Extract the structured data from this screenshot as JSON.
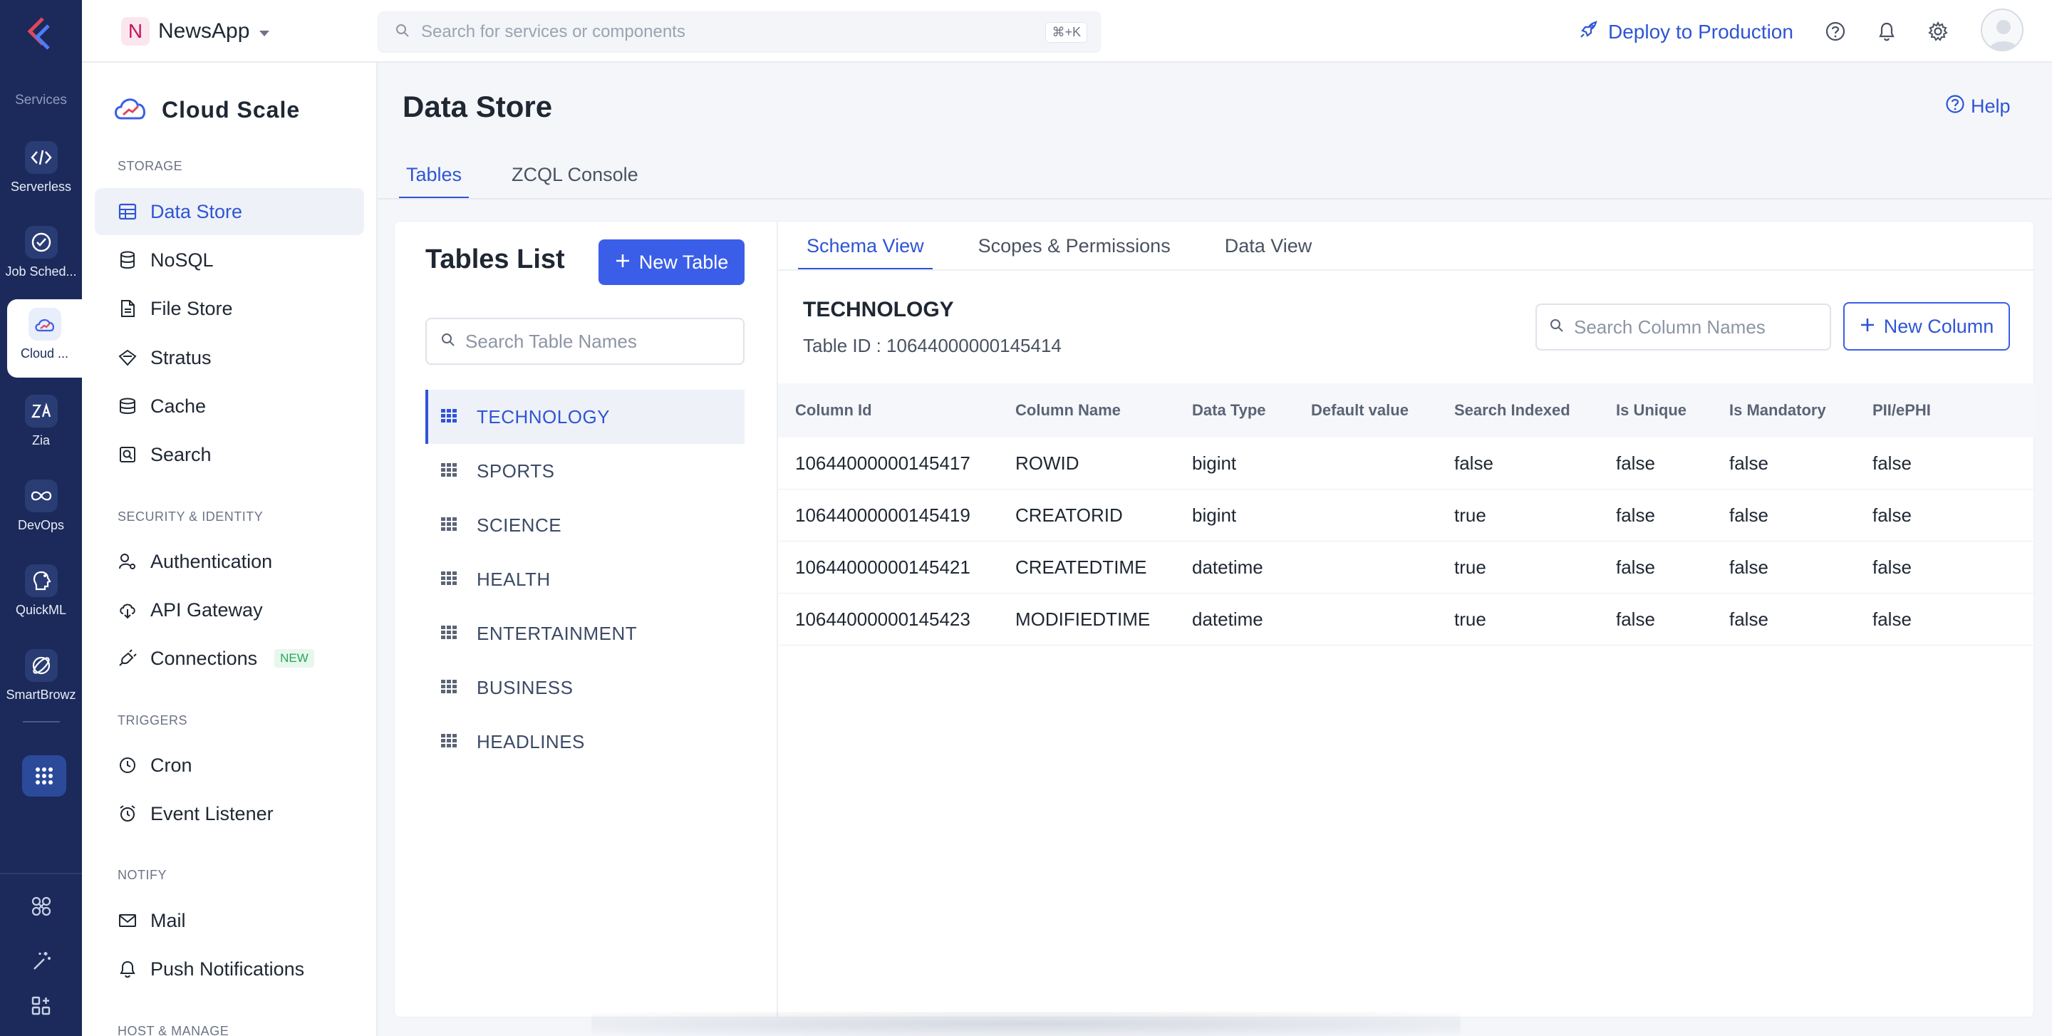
{
  "rail": {
    "section_label": "Services",
    "items": [
      {
        "label": "Serverless",
        "icon": "serverless-icon"
      },
      {
        "label": "Job Sched...",
        "icon": "job-scheduling-icon"
      },
      {
        "label": "Cloud ...",
        "icon": "cloud-scale-icon",
        "active": true
      },
      {
        "label": "Zia",
        "icon": "zia-icon"
      },
      {
        "label": "DevOps",
        "icon": "devops-icon"
      },
      {
        "label": "QuickML",
        "icon": "quickml-icon"
      },
      {
        "label": "SmartBrowz",
        "icon": "smartbrowz-icon"
      }
    ]
  },
  "topbar": {
    "project_initial": "N",
    "project_name": "NewsApp",
    "search_placeholder": "Search for services or components",
    "search_shortcut": "⌘+K",
    "deploy_label": "Deploy to Production"
  },
  "snav": {
    "title": "Cloud Scale",
    "groups": {
      "storage": "STORAGE",
      "security": "SECURITY & IDENTITY",
      "triggers": "TRIGGERS",
      "notify": "NOTIFY",
      "host": "HOST & MANAGE"
    },
    "items": {
      "data_store": "Data Store",
      "nosql": "NoSQL",
      "file_store": "File Store",
      "stratus": "Stratus",
      "cache": "Cache",
      "search": "Search",
      "authentication": "Authentication",
      "api_gateway": "API Gateway",
      "connections": "Connections",
      "connections_badge": "NEW",
      "cron": "Cron",
      "event_listener": "Event Listener",
      "mail": "Mail",
      "push_notifications": "Push Notifications"
    }
  },
  "main": {
    "title": "Data Store",
    "help_label": "Help",
    "tabs": [
      "Tables",
      "ZCQL Console"
    ]
  },
  "tables_list": {
    "title": "Tables List",
    "new_table_label": "New Table",
    "search_placeholder": "Search Table Names",
    "tables": [
      "TECHNOLOGY",
      "SPORTS",
      "SCIENCE",
      "HEALTH",
      "ENTERTAINMENT",
      "BUSINESS",
      "HEADLINES"
    ]
  },
  "schema": {
    "tabs": [
      "Schema View",
      "Scopes & Permissions",
      "Data View"
    ],
    "table_name": "TECHNOLOGY",
    "table_id": "Table ID : 10644000000145414",
    "column_search_placeholder": "Search Column Names",
    "new_column_label": "New Column",
    "headers": [
      "Column Id",
      "Column Name",
      "Data Type",
      "Default value",
      "Search Indexed",
      "Is Unique",
      "Is Mandatory",
      "PII/ePHI"
    ],
    "rows": [
      [
        "10644000000145417",
        "ROWID",
        "bigint",
        "",
        "false",
        "false",
        "false",
        "false"
      ],
      [
        "10644000000145419",
        "CREATORID",
        "bigint",
        "",
        "true",
        "false",
        "false",
        "false"
      ],
      [
        "10644000000145421",
        "CREATEDTIME",
        "datetime",
        "",
        "true",
        "false",
        "false",
        "false"
      ],
      [
        "10644000000145423",
        "MODIFIEDTIME",
        "datetime",
        "",
        "true",
        "false",
        "false",
        "false"
      ]
    ]
  },
  "colors": {
    "accent": "#3b5ee8",
    "rail_bg": "#1b2a5a",
    "new_badge": "#2aa55b"
  }
}
